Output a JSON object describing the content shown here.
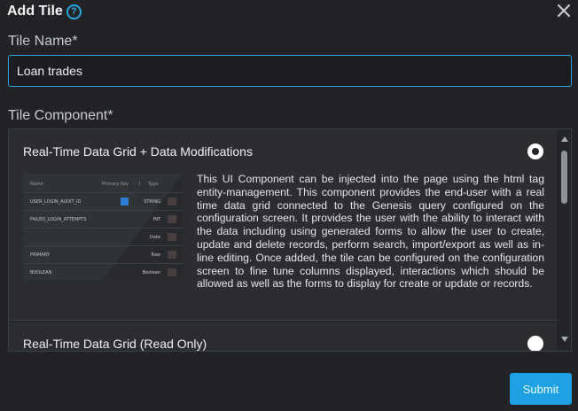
{
  "dialog": {
    "title": "Add Tile",
    "help_glyph": "?",
    "help_icon": "question-circle-icon",
    "close_icon": "close-icon"
  },
  "tile_name": {
    "label": "Tile Name*",
    "value": "Loan trades"
  },
  "tile_component": {
    "label": "Tile Component*",
    "options": [
      {
        "title": "Real-Time Data Grid + Data Modifications",
        "selected": true,
        "description": "This UI Component can be injected into the page using the html tag entity-management. This component provides the end-user with a real time data grid connected to the Genesis query configured on the configuration screen. It provides the user with the ability to interact with the data including using generated forms to allow the user to create, update and delete records, perform search, import/export as well as in-line editing. Once added, the tile can be configured on the configuration screen to fine tune columns displayed, interactions which should be allowed as well as the forms to display for create or update or records.",
        "preview": {
          "headers": [
            "Name",
            "Primary Key",
            "I",
            "Type"
          ],
          "rows": [
            {
              "name": "USER_LOGIN_AUDIT_ID",
              "type": "STRING",
              "checked": true
            },
            {
              "name": "FAILED_LOGIN_ATTEMPTS",
              "type": "INT",
              "checked": false
            },
            {
              "name": "",
              "type": "Date",
              "checked": false
            },
            {
              "name": "PRIMARY",
              "type": "Raw",
              "checked": false
            },
            {
              "name": "BOOLEAN",
              "type": "Boolean",
              "checked": false
            }
          ]
        }
      },
      {
        "title": "Real-Time Data Grid (Read Only)",
        "selected": false
      }
    ]
  },
  "actions": {
    "submit_label": "Submit"
  },
  "colors": {
    "background": "#212326",
    "accent": "#1da1e2",
    "panel": "#2b2d31"
  }
}
